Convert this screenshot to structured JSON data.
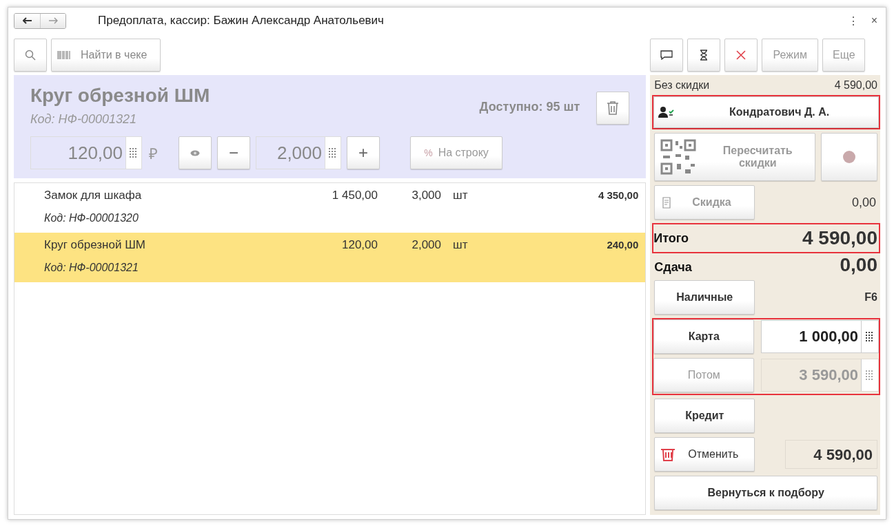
{
  "window": {
    "title": "Предоплата, кассир: Бажин Александр Анатольевич",
    "menu_icon": "⋮",
    "close_icon": "×"
  },
  "left_toolbar": {
    "find_button": "Найти в чеке"
  },
  "right_toolbar": {
    "mode_button": "Режим",
    "more_button": "Еще"
  },
  "current_item": {
    "name": "Круг обрезной ШМ",
    "code": "Код: НФ-00001321",
    "available": "Доступно: 95 шт",
    "price": "120,00",
    "currency": "₽",
    "quantity": "2,000",
    "minus": "−",
    "plus": "+",
    "discount_button": "На строку",
    "discount_icon": "%"
  },
  "rows": [
    {
      "name": "Замок для шкафа",
      "code": "Код: НФ-00001320",
      "price": "1 450,00",
      "quantity": "3,000",
      "unit": "шт",
      "sum": "4 350,00",
      "selected": false
    },
    {
      "name": "Круг обрезной ШМ",
      "code": "Код: НФ-00001321",
      "price": "120,00",
      "quantity": "2,000",
      "unit": "шт",
      "sum": "240,00",
      "selected": true
    }
  ],
  "summary": {
    "no_discount_label": "Без скидки",
    "no_discount_value": "4 590,00",
    "customer": {
      "label": "Кондратович Д. А.",
      "highlighted": true
    },
    "recalc_button": "Пересчитать скидки",
    "discount_button": "Скидка",
    "discount_value": "0,00",
    "total": {
      "label": "Итого",
      "value": "4 590,00",
      "highlighted": true
    },
    "change_label": "Сдача",
    "change_value": "0,00"
  },
  "payments": {
    "highlighted": true,
    "cash_button": "Наличные",
    "cash_hotkey": "F6",
    "lines": [
      {
        "label": "Карта",
        "value": "1 000,00",
        "disabled": false
      },
      {
        "label": "Потом",
        "value": "3 590,00",
        "disabled": true
      }
    ],
    "credit_button": "Кредит",
    "cancel_button": "Отменить",
    "remaining": "4 590,00",
    "back_button": "Вернуться к подбору"
  }
}
